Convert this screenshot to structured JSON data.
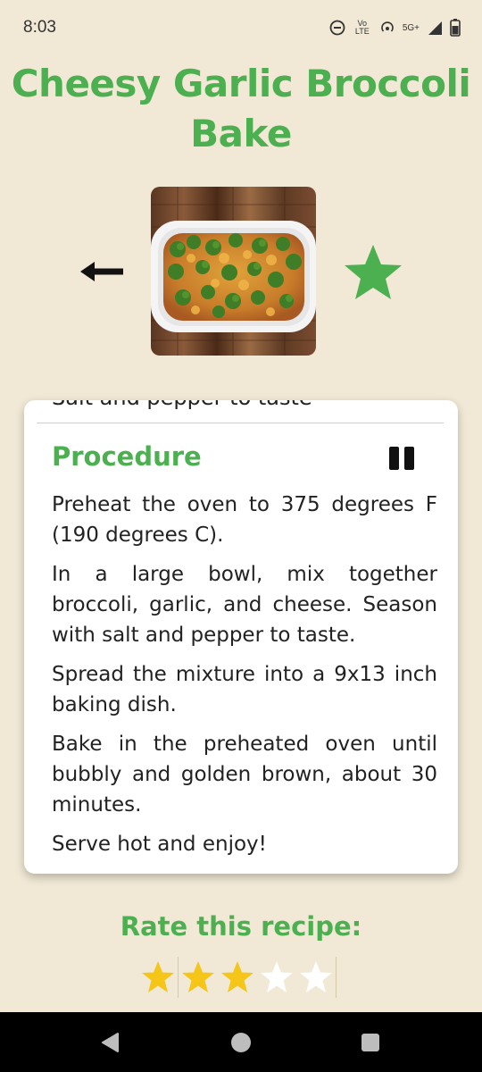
{
  "status_bar": {
    "time": "8:03",
    "network_label": "Vo LTE",
    "signal_label": "5G+",
    "icons": [
      "do-not-disturb-icon",
      "volte-icon",
      "hotspot-icon",
      "5g-icon",
      "signal-icon",
      "battery-icon"
    ]
  },
  "recipe": {
    "title": "Cheesy Garlic Broccoli Bake",
    "image_alt": "Broccoli bake in white baking dish",
    "back_icon": "arrow-left-icon",
    "favorite_icon": "star-icon",
    "favorite_color": "#4caf50"
  },
  "card": {
    "cut_off_top_text": "Salt and pepper to taste",
    "procedure_heading": "Procedure",
    "pause_icon": "pause-icon",
    "steps": [
      "Preheat the oven to 375 degrees F (190 degrees C).",
      "In a large bowl, mix together broccoli, garlic, and cheese. Season with salt and pepper to taste.",
      "Spread the mixture into a 9x13 inch baking dish.",
      "Bake in the preheated oven until bubbly and golden brown, about 30 minutes.",
      "Serve hot and enjoy!"
    ]
  },
  "rating": {
    "label": "Rate this recipe:",
    "value": 3,
    "max": 5,
    "filled_color": "#f5c518",
    "empty_color": "#ffffff"
  },
  "nav": {
    "icons": [
      "back-triangle-icon",
      "home-circle-icon",
      "recents-square-icon"
    ]
  },
  "theme": {
    "accent": "#4caf50",
    "background": "#f1e9d6"
  }
}
